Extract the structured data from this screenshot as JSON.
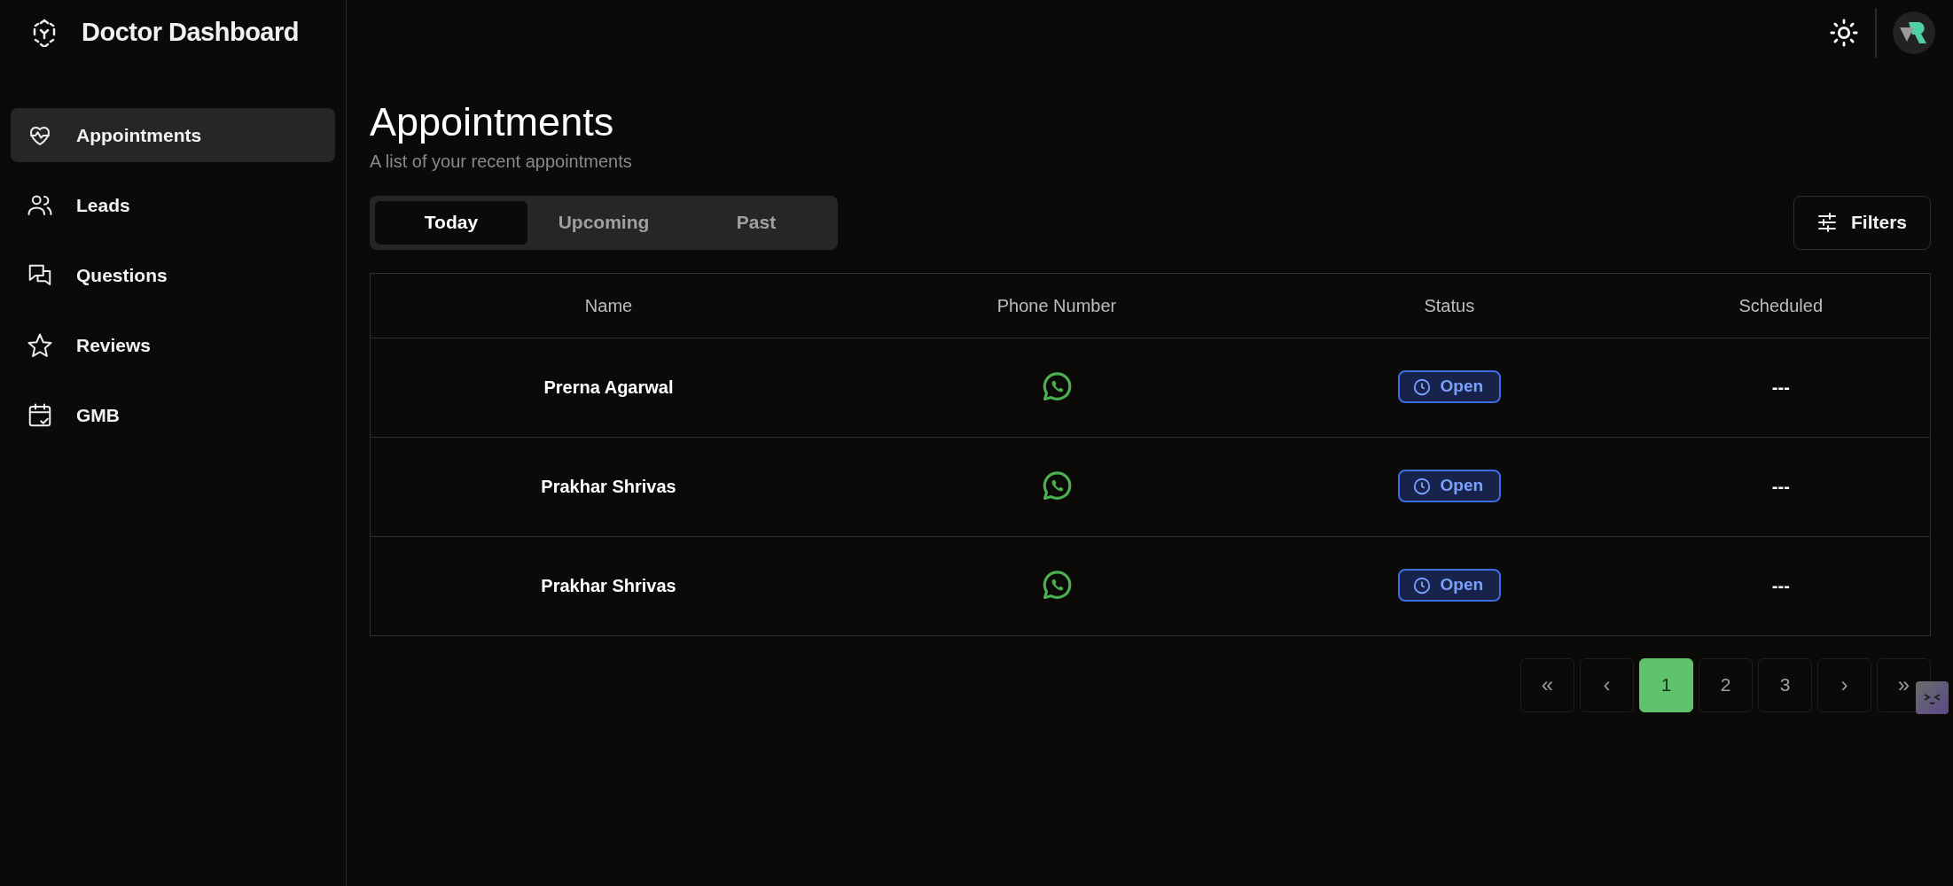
{
  "app": {
    "title": "Doctor Dashboard"
  },
  "sidebar": {
    "items": [
      {
        "label": "Appointments",
        "kind": "heart",
        "selected": true
      },
      {
        "label": "Leads",
        "kind": "users",
        "selected": false
      },
      {
        "label": "Questions",
        "kind": "chat",
        "selected": false
      },
      {
        "label": "Reviews",
        "kind": "star",
        "selected": false
      },
      {
        "label": "GMB",
        "kind": "calendar",
        "selected": false
      }
    ]
  },
  "page": {
    "title": "Appointments",
    "subtitle": "A list of your recent appointments"
  },
  "tabs": [
    {
      "label": "Today",
      "selected": true
    },
    {
      "label": "Upcoming",
      "selected": false
    },
    {
      "label": "Past",
      "selected": false
    }
  ],
  "filters_button": {
    "label": "Filters"
  },
  "table": {
    "columns": [
      "Name",
      "Phone Number",
      "Status",
      "Scheduled"
    ],
    "rows": [
      {
        "name": "Prerna Agarwal",
        "status": "Open",
        "scheduled": "---"
      },
      {
        "name": "Prakhar Shrivas",
        "status": "Open",
        "scheduled": "---"
      },
      {
        "name": "Prakhar Shrivas",
        "status": "Open",
        "scheduled": "---"
      }
    ]
  },
  "pagination": [
    {
      "label": "«",
      "kind": "first",
      "selected": false
    },
    {
      "label": "‹",
      "kind": "prev",
      "selected": false
    },
    {
      "label": "1",
      "kind": "page",
      "selected": true
    },
    {
      "label": "2",
      "kind": "page",
      "selected": false
    },
    {
      "label": "3",
      "kind": "page",
      "selected": false
    },
    {
      "label": "›",
      "kind": "next",
      "selected": false
    },
    {
      "label": "»",
      "kind": "last",
      "selected": false
    }
  ]
}
